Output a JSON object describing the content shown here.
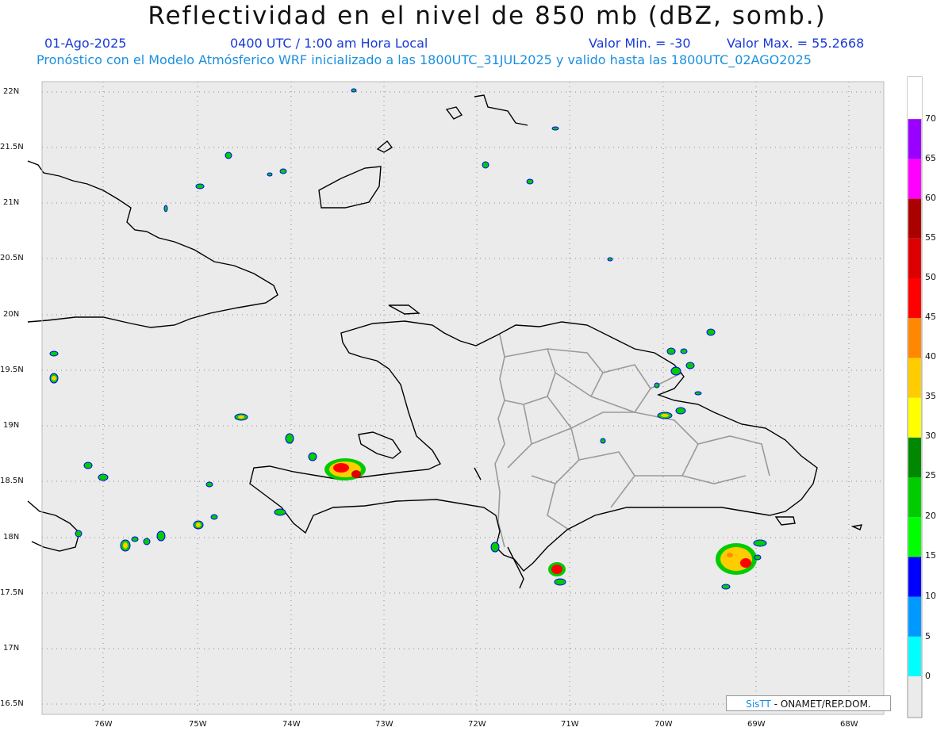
{
  "header": {
    "title": "Reflectividad en el nivel de 850 mb (dBZ, somb.)",
    "date": "01-Ago-2025",
    "time": "0400 UTC / 1:00 am Hora Local",
    "value_min": "Valor Min. = -30",
    "value_max": "Valor Max. = 55.2668",
    "forecast": "Pronóstico con el Modelo Atmósferico WRF inicializado a las 1800UTC_31JUL2025 y valido hasta las  1800UTC_02AGO2025"
  },
  "axes": {
    "lat_labels": [
      "22N",
      "21.5N",
      "21N",
      "20.5N",
      "20N",
      "19.5N",
      "19N",
      "18.5N",
      "18N",
      "17.5N",
      "17N",
      "16.5N"
    ],
    "lon_labels": [
      "76W",
      "75W",
      "74W",
      "73W",
      "72W",
      "71W",
      "70W",
      "69W",
      "68W"
    ],
    "lat_range": [
      16.5,
      22
    ],
    "lon_range": [
      -76.5,
      -67.5
    ],
    "grid": "dotted"
  },
  "colorbar": {
    "labels": [
      "0",
      "5",
      "10",
      "15",
      "20",
      "25",
      "30",
      "35",
      "40",
      "45",
      "50",
      "55",
      "60",
      "65",
      "70"
    ],
    "colors": [
      "#00ffff",
      "#0099ff",
      "#0000ff",
      "#00ff00",
      "#00cc00",
      "#008800",
      "#ffff00",
      "#ffcc00",
      "#ff8800",
      "#ff0000",
      "#dd0000",
      "#aa0000",
      "#ff00ff",
      "#9900ff"
    ],
    "background": "#ebebeb"
  },
  "credit": {
    "brand": "SisTT",
    "text": "- ONAMET/REP.DOM."
  },
  "colors": {
    "map_bg": "#ebebeb",
    "coast": "#000000",
    "border": "#999999",
    "title_blue": "#1a3bd6",
    "sub_blue": "#1a8fe0"
  }
}
